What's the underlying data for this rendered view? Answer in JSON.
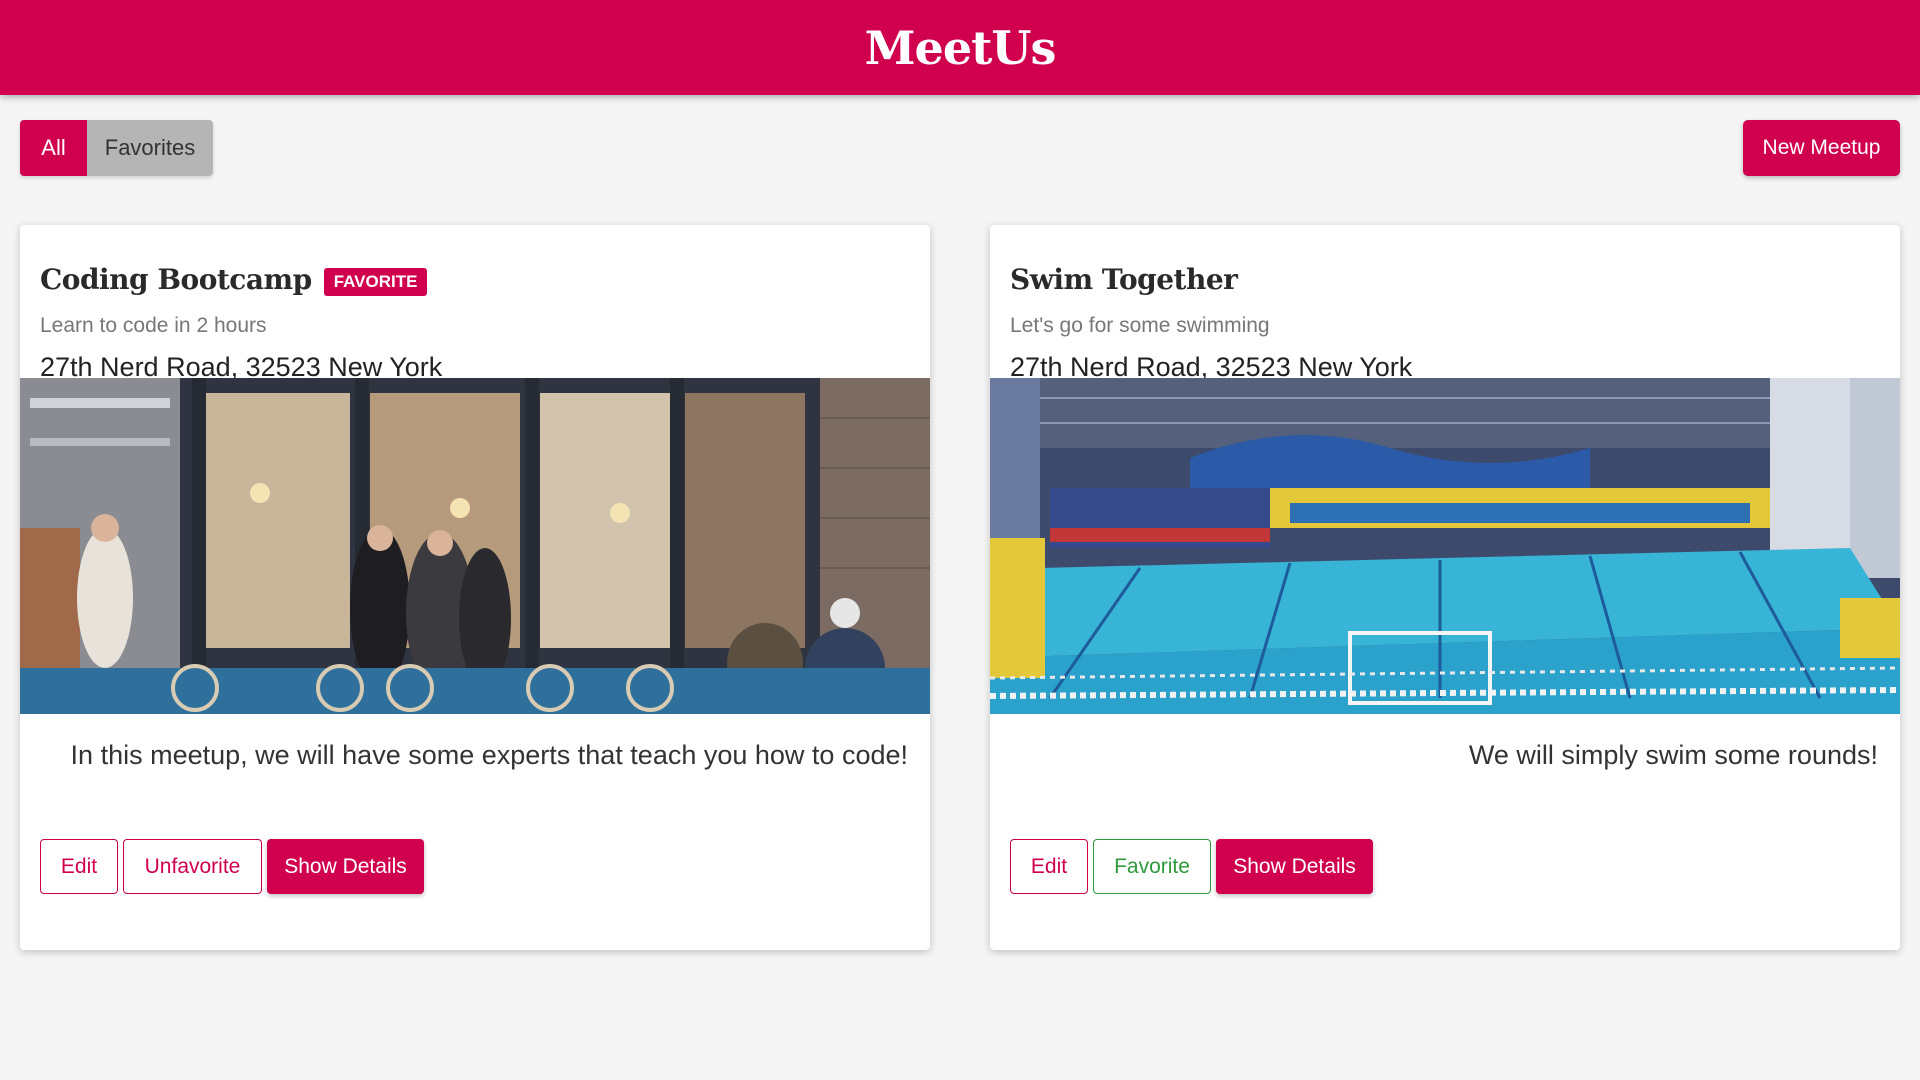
{
  "header": {
    "title": "MeetUs"
  },
  "filters": {
    "all_label": "All",
    "favorites_label": "Favorites"
  },
  "toolbar": {
    "new_meetup_label": "New Meetup"
  },
  "meetups": [
    {
      "title": "Coding Bootcamp",
      "badge": "FAVORITE",
      "subtitle": "Learn to code in 2 hours",
      "address": "27th Nerd Road, 32523 New York",
      "image_icon": "cafe-storefront-photo",
      "description": "In this meetup, we will have some experts that teach you how to code!",
      "edit_label": "Edit",
      "favorite_label": "Unfavorite",
      "details_label": "Show Details"
    },
    {
      "title": "Swim Together",
      "subtitle": "Let's go for some swimming",
      "address": "27th Nerd Road, 32523 New York",
      "image_icon": "swimming-pool-photo",
      "description": "We will simply swim some rounds!",
      "edit_label": "Edit",
      "favorite_label": "Favorite",
      "details_label": "Show Details"
    }
  ],
  "colors": {
    "primary": "#d0004f",
    "success": "#2e9a3c",
    "background": "#f5f5f5"
  }
}
